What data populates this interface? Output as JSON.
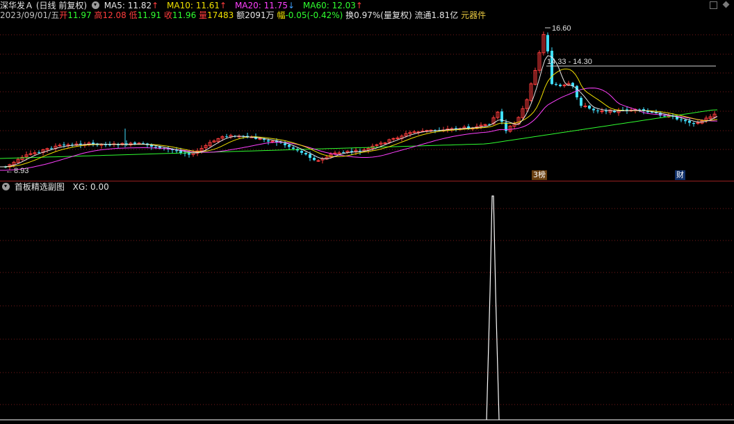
{
  "header": {
    "stock_name": "深华发Ａ",
    "period": "(日线 前复权)",
    "ma5": "MA5: 11.82",
    "ma5_arrow": "↑",
    "ma10": "MA10: 11.61",
    "ma10_arrow": "↑",
    "ma20": "MA20: 11.75",
    "ma20_arrow": "↓",
    "ma60": "MA60: 12.03",
    "ma60_arrow": "↑"
  },
  "quote": {
    "date": "2023/09/01/五",
    "open_label": "开",
    "open": "11.97",
    "high_label": "高",
    "high": "12.08",
    "low_label": "低",
    "low": "11.91",
    "close_label": "收",
    "close": "11.96",
    "volume_label": "量",
    "volume": "17483",
    "amount_label": "额",
    "amount": "2091万",
    "change_label": "幅",
    "change": "-0.05(-0.42%)",
    "turnover": "换0.97%(量复权)",
    "float_cap": "流通1.81亿",
    "sector": "元器件"
  },
  "annotations": {
    "high_price": "16.60",
    "range": "14.33 - 14.30",
    "low_price": "8.93",
    "low_arrow": "←",
    "tag_a": "3榜",
    "tag_b": "财"
  },
  "subchart": {
    "title": "首板精选副图",
    "value": "XG: 0.00"
  },
  "colors": {
    "up": "#ff3d3d",
    "down": "#40e0ff",
    "ma5": "#e6e6e6",
    "ma10": "#f0e000",
    "ma20": "#ff40ff",
    "ma60": "#30ff30",
    "grid": "#7a1a1a",
    "signal": "#ffffff"
  },
  "chart_data": {
    "type": "candlestick",
    "ma_series": [
      "MA5",
      "MA10",
      "MA20",
      "MA60"
    ],
    "visible_high": 16.6,
    "visible_low": 8.93,
    "last_close": 11.96,
    "subchart_series": {
      "name": "XG",
      "value": 0.0,
      "signal_spike": 1
    }
  }
}
